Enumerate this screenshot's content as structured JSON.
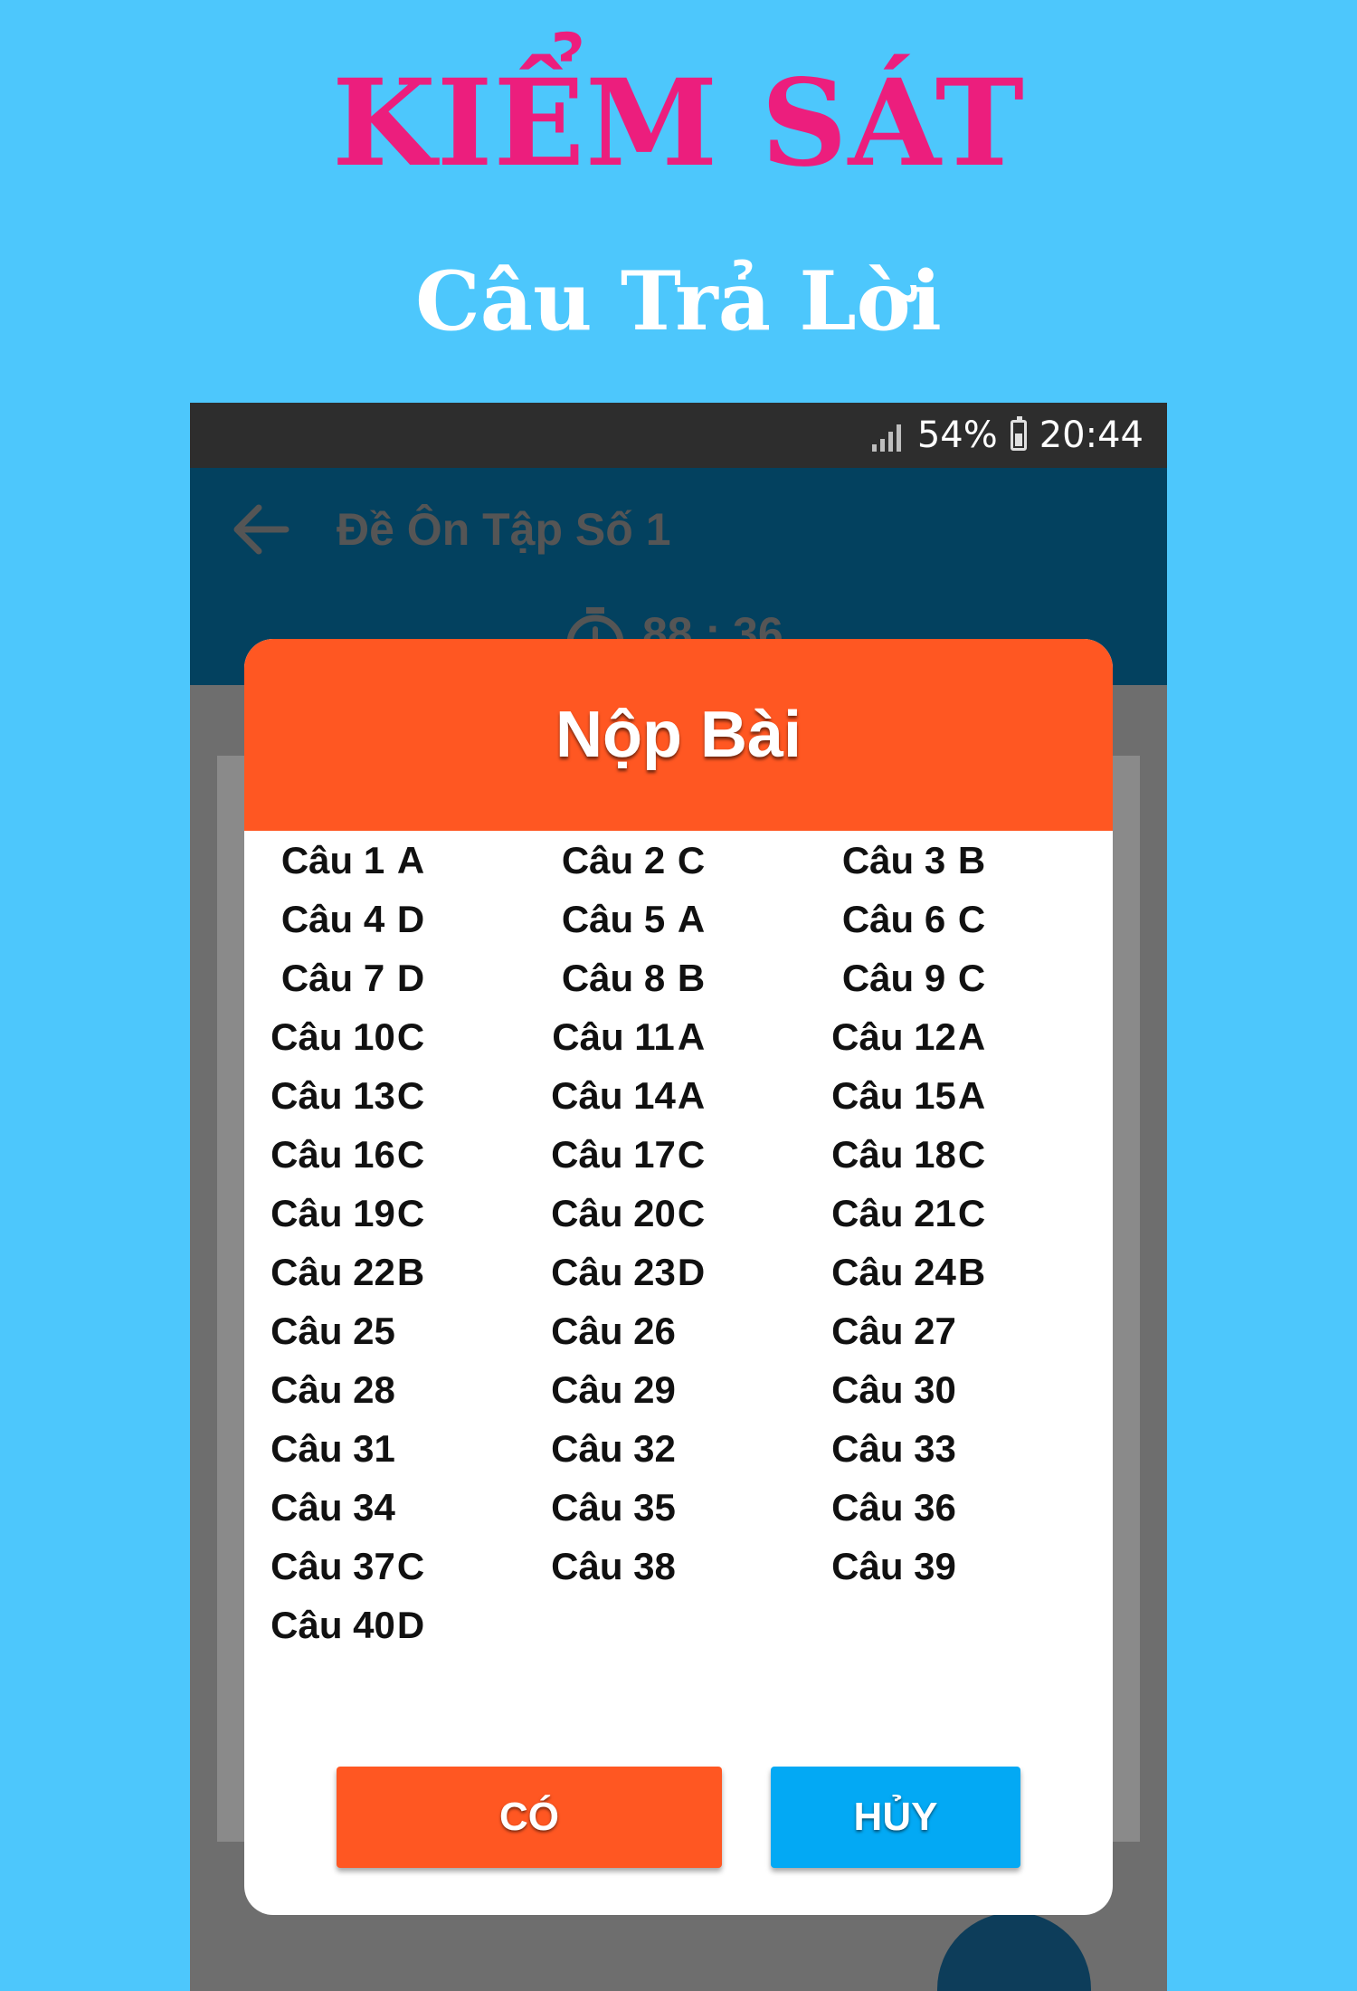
{
  "promo": {
    "title": "KIỂM SÁT",
    "subtitle": "Câu Trả Lời"
  },
  "status_bar": {
    "battery": "54%",
    "time": "20:44"
  },
  "app_bar": {
    "title": "Đề Ôn Tập Số 1",
    "timer": "88 : 36"
  },
  "dialog": {
    "title": "Nộp Bài",
    "confirm_label": "CÓ",
    "cancel_label": "HỦY",
    "answers": [
      {
        "q": "Câu 1",
        "a": "A"
      },
      {
        "q": "Câu 2",
        "a": "C"
      },
      {
        "q": "Câu 3",
        "a": "B"
      },
      {
        "q": "Câu 4",
        "a": "D"
      },
      {
        "q": "Câu 5",
        "a": "A"
      },
      {
        "q": "Câu 6",
        "a": "C"
      },
      {
        "q": "Câu 7",
        "a": "D"
      },
      {
        "q": "Câu 8",
        "a": "B"
      },
      {
        "q": "Câu 9",
        "a": "C"
      },
      {
        "q": "Câu 10",
        "a": "C"
      },
      {
        "q": "Câu 11",
        "a": "A"
      },
      {
        "q": "Câu 12",
        "a": "A"
      },
      {
        "q": "Câu 13",
        "a": "C"
      },
      {
        "q": "Câu 14",
        "a": "A"
      },
      {
        "q": "Câu 15",
        "a": "A"
      },
      {
        "q": "Câu 16",
        "a": "C"
      },
      {
        "q": "Câu 17",
        "a": "C"
      },
      {
        "q": "Câu 18",
        "a": "C"
      },
      {
        "q": "Câu 19",
        "a": "C"
      },
      {
        "q": "Câu 20",
        "a": "C"
      },
      {
        "q": "Câu 21",
        "a": "C"
      },
      {
        "q": "Câu 22",
        "a": "B"
      },
      {
        "q": "Câu 23",
        "a": "D"
      },
      {
        "q": "Câu 24",
        "a": "B"
      },
      {
        "q": "Câu 25",
        "a": ""
      },
      {
        "q": "Câu 26",
        "a": ""
      },
      {
        "q": "Câu 27",
        "a": ""
      },
      {
        "q": "Câu 28",
        "a": ""
      },
      {
        "q": "Câu 29",
        "a": ""
      },
      {
        "q": "Câu 30",
        "a": ""
      },
      {
        "q": "Câu 31",
        "a": ""
      },
      {
        "q": "Câu 32",
        "a": ""
      },
      {
        "q": "Câu 33",
        "a": ""
      },
      {
        "q": "Câu 34",
        "a": ""
      },
      {
        "q": "Câu 35",
        "a": ""
      },
      {
        "q": "Câu 36",
        "a": ""
      },
      {
        "q": "Câu 37",
        "a": "C"
      },
      {
        "q": "Câu 38",
        "a": ""
      },
      {
        "q": "Câu 39",
        "a": ""
      },
      {
        "q": "Câu 40",
        "a": "D"
      }
    ]
  },
  "colors": {
    "background": "#4dc7fc",
    "brand_pink": "#ec1e7d",
    "dialog_header": "#ff5722",
    "cancel_button": "#03a9f4",
    "app_bar": "#03415f"
  },
  "icons": {
    "back": "arrow-left-icon",
    "timer": "stopwatch-icon",
    "signal": "signal-bars-icon",
    "battery": "battery-icon"
  }
}
